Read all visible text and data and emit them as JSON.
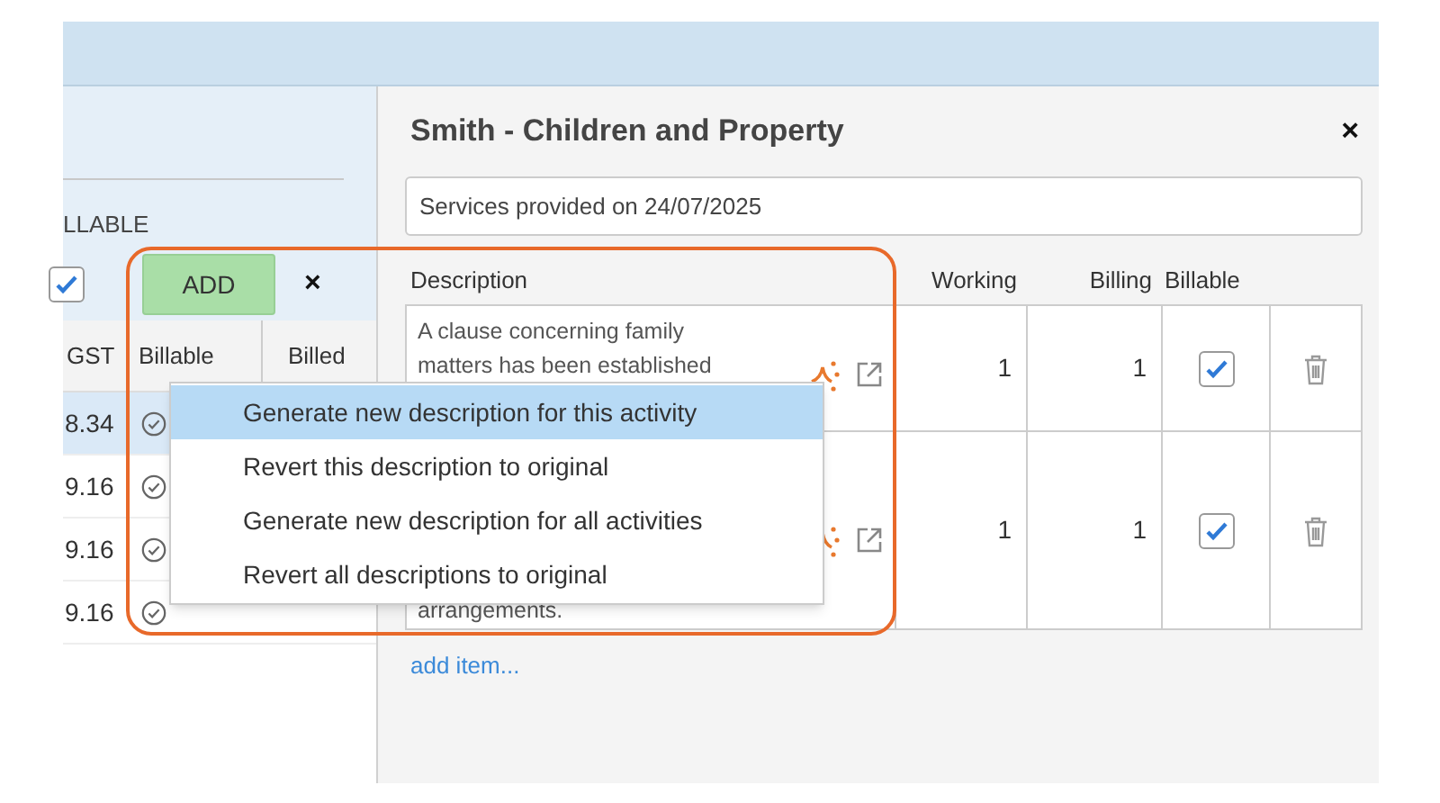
{
  "left_panel": {
    "filter_label": "LLABLE",
    "filter_checked": true,
    "add_button": "ADD",
    "clear_button": "×",
    "columns": [
      "GST",
      "Billable",
      "Billed"
    ],
    "rows": [
      {
        "gst": "8.34",
        "selected": true
      },
      {
        "gst": "9.16",
        "selected": false
      },
      {
        "gst": "9.16",
        "selected": false
      },
      {
        "gst": "9.16",
        "selected": false
      }
    ]
  },
  "detail_panel": {
    "title": "Smith - Children and Property",
    "close_button": "×",
    "summary_field": {
      "value": "Services provided on 24/07/2025"
    },
    "columns": [
      "Description",
      "Working",
      "Billing",
      "Billable"
    ],
    "rows": [
      {
        "description": [
          "A clause concerning family",
          "matters has been established"
        ],
        "working": "1",
        "billing": "1",
        "billable": true
      },
      {
        "description": [
          "arrangements."
        ],
        "working": "1",
        "billing": "1",
        "billable": true
      }
    ],
    "add_item_link": "add item..."
  },
  "context_menu": {
    "items": [
      {
        "label": "Generate new description for this activity",
        "selected": true
      },
      {
        "label": "Revert this description to original",
        "selected": false
      },
      {
        "label": "Generate new description for all activities",
        "selected": false
      },
      {
        "label": "Revert all descriptions to original",
        "selected": false
      }
    ]
  }
}
